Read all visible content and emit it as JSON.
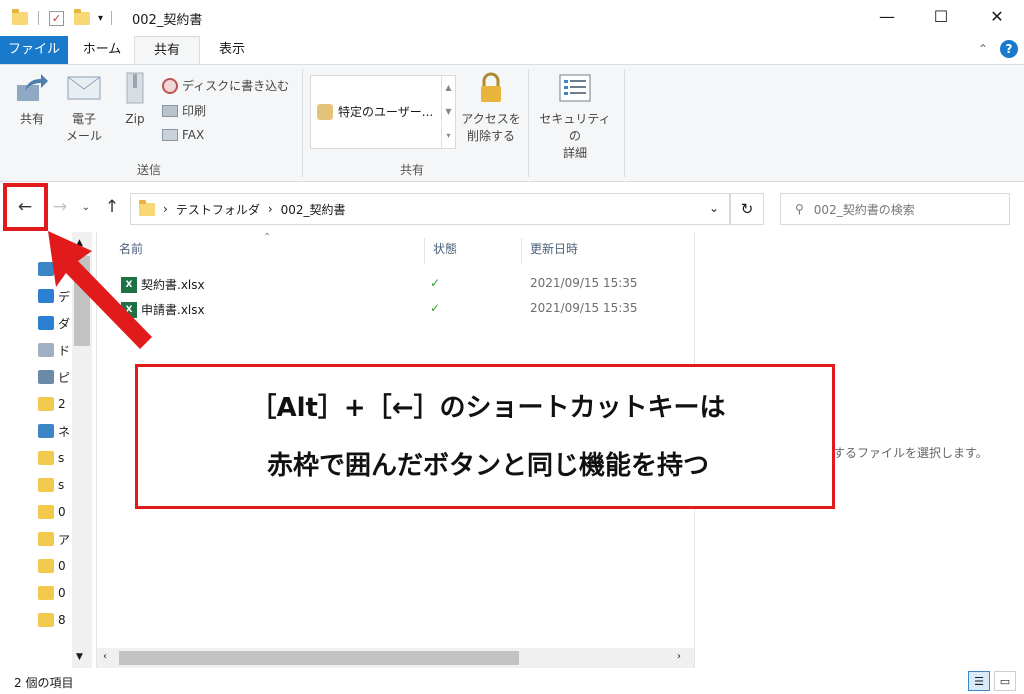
{
  "window": {
    "title": "002_契約書",
    "minimize": "—",
    "maximize": "☐",
    "close": "✕"
  },
  "ribbon_tabs": [
    {
      "label": "ファイル"
    },
    {
      "label": "ホーム"
    },
    {
      "label": "共有"
    },
    {
      "label": "表示"
    }
  ],
  "ribbon": {
    "share_label": "共有",
    "email_label_1": "電子",
    "email_label_2": "メール",
    "zip_label": "Zip",
    "burn_label": "ディスクに書き込む",
    "print_label": "印刷",
    "fax_label": "FAX",
    "send_group": "送信",
    "share_with": "特定のユーザー...",
    "share_group": "共有",
    "remove_access_1": "アクセスを",
    "remove_access_2": "削除する",
    "security_1": "セキュリティの",
    "security_2": "詳細"
  },
  "address": {
    "path": [
      "テストフォルダ",
      "002_契約書"
    ],
    "separator": "›",
    "search_placeholder": "002_契約書の検索"
  },
  "nav_items": [
    {
      "initial": "ク",
      "icon": "star-icon"
    },
    {
      "initial": "デ",
      "icon": "desktop-icon"
    },
    {
      "initial": "ダ",
      "icon": "download-icon"
    },
    {
      "initial": "ド",
      "icon": "document-icon"
    },
    {
      "initial": "ピ",
      "icon": "picture-icon"
    },
    {
      "initial": "2",
      "icon": "folder-icon"
    },
    {
      "initial": "ネ",
      "icon": "network-icon"
    },
    {
      "initial": "s",
      "icon": "folder-icon"
    },
    {
      "initial": "s",
      "icon": "folder-icon"
    },
    {
      "initial": "0",
      "icon": "folder-icon"
    },
    {
      "initial": "ア",
      "icon": "folder-icon"
    },
    {
      "initial": "0",
      "icon": "folder-icon"
    },
    {
      "initial": "0",
      "icon": "folder-icon"
    },
    {
      "initial": "8",
      "icon": "folder-icon"
    }
  ],
  "columns": {
    "name": "名前",
    "state": "状態",
    "modified": "更新日時"
  },
  "files": [
    {
      "name": "契約書.xlsx",
      "state": "✓",
      "date": "2021/09/15 15:35"
    },
    {
      "name": "申請書.xlsx",
      "state": "✓",
      "date": "2021/09/15 15:35"
    }
  ],
  "preview_text": "プレビューを表示するファイルを選択します。",
  "status": {
    "count": "2 個の項目"
  },
  "annotation": {
    "line1": "［Alt］+［←］のショートカットキーは",
    "line2": "赤枠で囲んだボタンと同じ機能を持つ"
  },
  "colors": {
    "accent": "#1979ca",
    "highlight": "#e11b1b"
  }
}
